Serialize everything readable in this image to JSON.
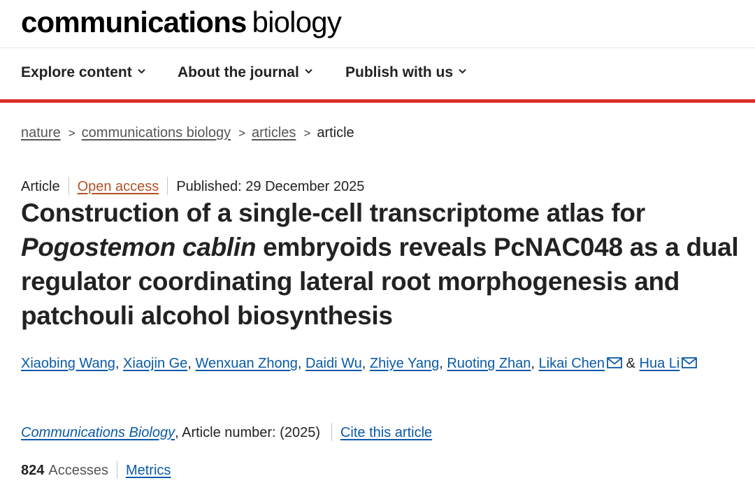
{
  "brand": {
    "bold": "communications",
    "light": "biology"
  },
  "nav": [
    {
      "label": "Explore content"
    },
    {
      "label": "About the journal"
    },
    {
      "label": "Publish with us"
    }
  ],
  "breadcrumb": [
    "nature",
    "communications biology",
    "articles",
    "article"
  ],
  "meta": {
    "type": "Article",
    "access": "Open access",
    "published": "Published: 29 December 2025"
  },
  "title": {
    "line1": "Construction of a single-cell transcriptome atlas for ",
    "italic": "Pogostemon cablin",
    "rest": " embryoids reveals PcNAC048 as a dual regulator coordinating lateral root morphogenesis and patchouli alcohol biosynthesis"
  },
  "authors": [
    "Xiaobing Wang",
    "Xiaojin Ge",
    "Wenxuan Zhong",
    "Daidi Wu",
    "Zhiye Yang",
    "Ruoting Zhan",
    "Likai Chen",
    "Hua Li"
  ],
  "author_joiner": "&",
  "citation": {
    "journal": "Communications Biology",
    "article_number": ", Article number:  (2025)",
    "cite": "Cite this article"
  },
  "metrics": {
    "count": "824",
    "label": "Accesses",
    "link": "Metrics"
  },
  "icons": {
    "nav_chevron": "chevron-down-icon",
    "author_email": "mail-icon"
  },
  "colors": {
    "accent_red": "#d9302c",
    "link_blue": "#0a5aa8",
    "open_access": "#b35128"
  }
}
